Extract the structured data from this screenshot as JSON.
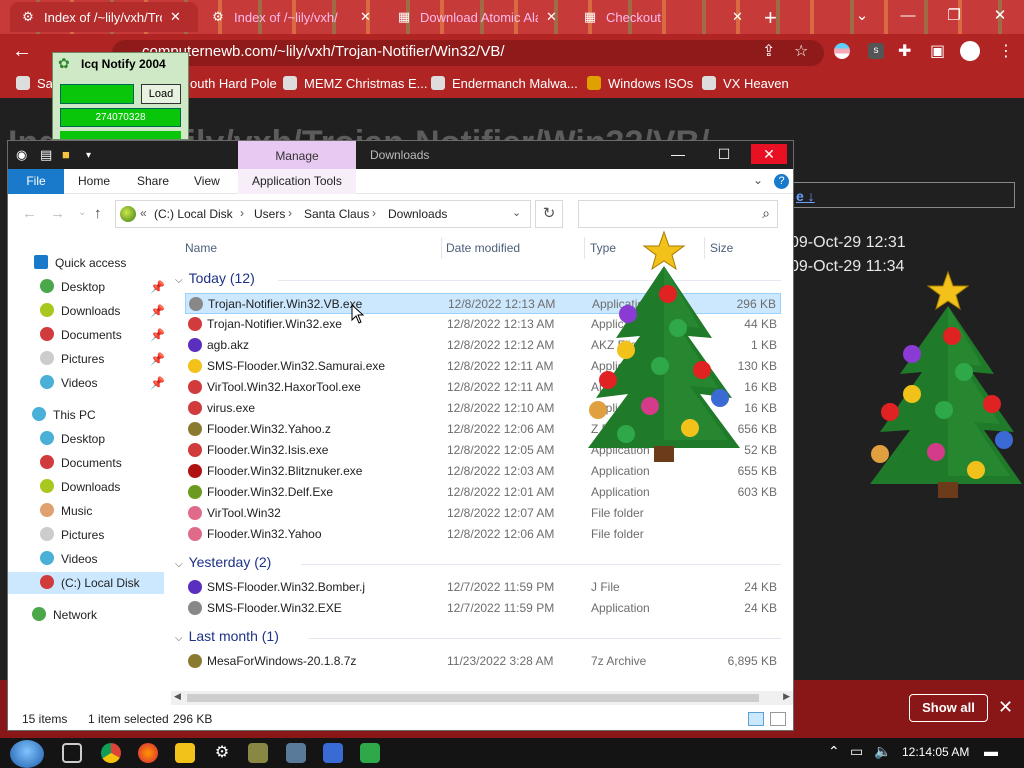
{
  "browser": {
    "tabs": [
      {
        "title": "Index of /~lily/vxh/Troj",
        "active": true
      },
      {
        "title": "Index of /~lily/vxh/",
        "active": false
      },
      {
        "title": "Download Atomic Ala",
        "active": false
      },
      {
        "title": "Checkout",
        "active": false
      }
    ],
    "url": "computernewb.com/~lily/vxh/Trojan-Notifier/Win32/VB/",
    "bookmarks": [
      "Sa",
      "outh Hard Pole",
      "MEMZ Christmas E...",
      "Endermanch Malwa...",
      "Windows ISOs",
      "VX Heaven"
    ]
  },
  "page": {
    "heading": "Index of /~lily/vxh/Trojan-Notifier/Win32/VB/",
    "link": "e ↓",
    "dates": [
      "09-Oct-29 12:31",
      "09-Oct-29 11:34"
    ],
    "show_all": "Show all"
  },
  "icq": {
    "title": "Icq Notify 2004",
    "load_label": "Load",
    "number": "274070328"
  },
  "explorer": {
    "contextual_tab": "Manage",
    "window_title": "Downloads",
    "ribbon_tabs": [
      "File",
      "Home",
      "Share",
      "View",
      "Application Tools"
    ],
    "breadcrumb": [
      "(C:) Local Disk",
      "Users",
      "Santa Claus",
      "Downloads"
    ],
    "nav": {
      "quick_access": "Quick access",
      "quick_items": [
        "Desktop",
        "Downloads",
        "Documents",
        "Pictures",
        "Videos"
      ],
      "this_pc": "This PC",
      "pc_items": [
        "Desktop",
        "Documents",
        "Downloads",
        "Music",
        "Pictures",
        "Videos",
        "(C:) Local Disk"
      ],
      "network": "Network"
    },
    "columns": [
      "Name",
      "Date modified",
      "Type",
      "Size"
    ],
    "groups": [
      {
        "label": "Today (12)",
        "files": [
          {
            "name": "Trojan-Notifier.Win32.VB.exe",
            "date": "12/8/2022 12:13 AM",
            "type": "Application",
            "size": "296 KB",
            "selected": true,
            "color": "#888"
          },
          {
            "name": "Trojan-Notifier.Win32.exe",
            "date": "12/8/2022 12:13 AM",
            "type": "Application",
            "size": "44 KB",
            "color": "#d23b3b"
          },
          {
            "name": "agb.akz",
            "date": "12/8/2022 12:12 AM",
            "type": "AKZ File",
            "size": "1 KB",
            "color": "#5a2fc0"
          },
          {
            "name": "SMS-Flooder.Win32.Samurai.exe",
            "date": "12/8/2022 12:11 AM",
            "type": "Application",
            "size": "130 KB",
            "color": "#f2c21a"
          },
          {
            "name": "VirTool.Win32.HaxorTool.exe",
            "date": "12/8/2022 12:11 AM",
            "type": "Application",
            "size": "16 KB",
            "color": "#d23b3b"
          },
          {
            "name": "virus.exe",
            "date": "12/8/2022 12:10 AM",
            "type": "Application",
            "size": "16 KB",
            "color": "#d23b3b"
          },
          {
            "name": "Flooder.Win32.Yahoo.z",
            "date": "12/8/2022 12:06 AM",
            "type": "Z File",
            "size": "656 KB",
            "color": "#8a7a30"
          },
          {
            "name": "Flooder.Win32.Isis.exe",
            "date": "12/8/2022 12:05 AM",
            "type": "Application",
            "size": "52 KB",
            "color": "#d23b3b"
          },
          {
            "name": "Flooder.Win32.Blitznuker.exe",
            "date": "12/8/2022 12:03 AM",
            "type": "Application",
            "size": "655 KB",
            "color": "#b01212"
          },
          {
            "name": "Flooder.Win32.Delf.Exe",
            "date": "12/8/2022 12:01 AM",
            "type": "Application",
            "size": "603 KB",
            "color": "#6a9a20"
          },
          {
            "name": "VirTool.Win32",
            "date": "12/8/2022 12:07 AM",
            "type": "File folder",
            "size": "",
            "color": "#e06a8a"
          },
          {
            "name": "Flooder.Win32.Yahoo",
            "date": "12/8/2022 12:06 AM",
            "type": "File folder",
            "size": "",
            "color": "#e06a8a"
          }
        ]
      },
      {
        "label": "Yesterday (2)",
        "files": [
          {
            "name": "SMS-Flooder.Win32.Bomber.j",
            "date": "12/7/2022 11:59 PM",
            "type": "J File",
            "size": "24 KB",
            "color": "#5a2fc0"
          },
          {
            "name": "SMS-Flooder.Win32.EXE",
            "date": "12/7/2022 11:59 PM",
            "type": "Application",
            "size": "24 KB",
            "color": "#888"
          }
        ]
      },
      {
        "label": "Last month (1)",
        "files": [
          {
            "name": "MesaForWindows-20.1.8.7z",
            "date": "11/23/2022 3:28 AM",
            "type": "7z Archive",
            "size": "6,895 KB",
            "color": "#8a7a30"
          }
        ]
      }
    ],
    "status": {
      "count": "15 items",
      "selected": "1 item selected",
      "selected_size": "296 KB"
    }
  },
  "taskbar": {
    "clock": "12:14:05 AM"
  }
}
